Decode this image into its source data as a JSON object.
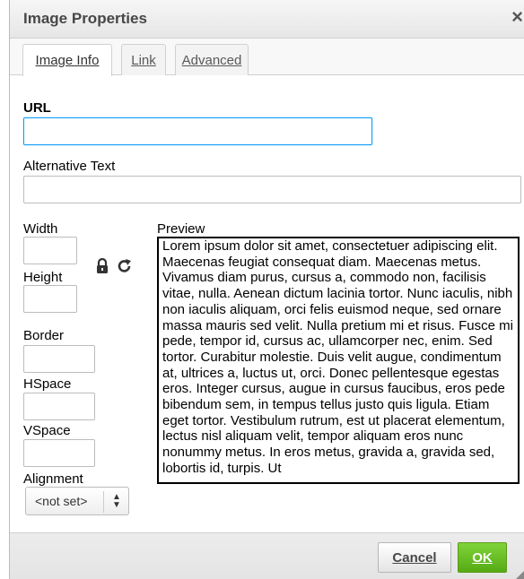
{
  "dialog": {
    "title": "Image Properties",
    "close_glyph": "×",
    "close_icon": "close-icon"
  },
  "tabs": [
    {
      "label": "Image Info",
      "active": true
    },
    {
      "label": "Link",
      "active": false
    },
    {
      "label": "Advanced",
      "active": false
    }
  ],
  "fields": {
    "url_label": "URL",
    "url_value": "",
    "alt_label": "Alternative Text",
    "alt_value": "",
    "width_label": "Width",
    "width_value": "",
    "height_label": "Height",
    "height_value": "",
    "border_label": "Border",
    "border_value": "",
    "hspace_label": "HSpace",
    "hspace_value": "",
    "vspace_label": "VSpace",
    "vspace_value": "",
    "alignment_label": "Alignment",
    "alignment_value": "<not set>"
  },
  "icons": {
    "lock": "lock-icon",
    "reset": "reset-size-icon",
    "select_arrows": "updown-arrows-icon"
  },
  "preview": {
    "label": "Preview",
    "text": "Lorem ipsum dolor sit amet, consectetuer adipiscing elit. Maecenas feugiat consequat diam. Maecenas metus. Vivamus diam purus, cursus a, commodo non, facilisis vitae, nulla. Aenean dictum lacinia tortor. Nunc iaculis, nibh non iaculis aliquam, orci felis euismod neque, sed ornare massa mauris sed velit. Nulla pretium mi et risus. Fusce mi pede, tempor id, cursus ac, ullamcorper nec, enim. Sed tortor. Curabitur molestie. Duis velit augue, condimentum at, ultrices a, luctus ut, orci. Donec pellentesque egestas eros. Integer cursus, augue in cursus faucibus, eros pede bibendum sem, in tempus tellus justo quis ligula. Etiam eget tortor. Vestibulum rutrum, est ut placerat elementum, lectus nisl aliquam velit, tempor aliquam eros nunc nonummy metus. In eros metus, gravida a, gravida sed, lobortis id, turpis. Ut"
  },
  "buttons": {
    "cancel": "Cancel",
    "ok": "OK"
  },
  "colors": {
    "focus_border": "#139ff7",
    "ok_green": "#62b820"
  }
}
